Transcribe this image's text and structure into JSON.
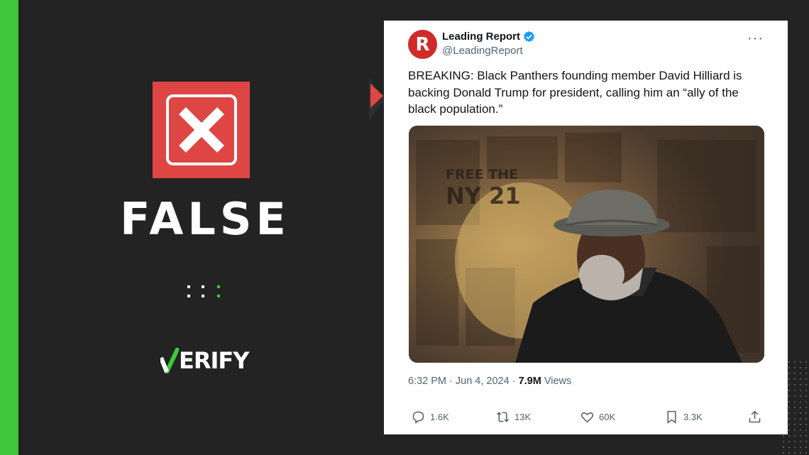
{
  "verdict": {
    "label": "FALSE",
    "color": "#de4644",
    "icon": "x-icon"
  },
  "brand": {
    "logo_text": "ERIFY",
    "logo_check_color": "#3fc63a",
    "accent": "#3fc63a"
  },
  "tweet": {
    "account": {
      "name": "Leading Report",
      "handle": "@LeadingReport",
      "avatar_letter": "R",
      "verified": true
    },
    "text": "BREAKING: Black Panthers founding member David Hilliard is backing Donald Trump for president, calling him an “ally of the black population.”",
    "photo_sign_line1": "FREE THE",
    "photo_sign_line2": "NY 21",
    "timestamp": "6:32 PM · Jun 4, 2024 · ",
    "views_count": "7.9M",
    "views_label": " Views",
    "actions": {
      "replies": "1.6K",
      "reposts": "13K",
      "likes": "60K",
      "bookmarks": "3.3K"
    }
  }
}
